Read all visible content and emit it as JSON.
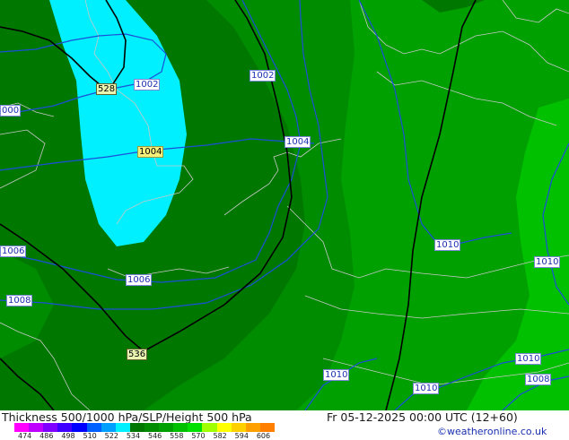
{
  "title": "Thickness 500/1000 hPa/SLP/Height 500 hPa",
  "datetime": "Fr 05-12-2025 00:00 UTC (12+60)",
  "credit": "©weatheronline.co.uk",
  "colors": {
    "band_536_542": "#00a000",
    "band_530_536": "#008c00",
    "band_524_530": "#007800",
    "band_542_548": "#00c000",
    "band_518_524": "#00f0ff",
    "isobar": "#1c4fd8",
    "thickness_line": "#000000",
    "coastline": "#c8c8c8"
  },
  "isobar_labels": [
    {
      "id": "p1002a",
      "text": "1002"
    },
    {
      "id": "p1002b",
      "text": "1002"
    },
    {
      "id": "p1004a",
      "text": "1004"
    },
    {
      "id": "p1004b",
      "text": "1004"
    },
    {
      "id": "p1000",
      "text": "000"
    },
    {
      "id": "p1006a",
      "text": "1006"
    },
    {
      "id": "p1006b",
      "text": "1006"
    },
    {
      "id": "p1008a",
      "text": "1008"
    },
    {
      "id": "p1008b",
      "text": "1008"
    },
    {
      "id": "p1010a",
      "text": "1010"
    },
    {
      "id": "p1010b",
      "text": "1010"
    },
    {
      "id": "p1010c",
      "text": "1010"
    },
    {
      "id": "p1010d",
      "text": "1010"
    },
    {
      "id": "p1010e",
      "text": "1010"
    }
  ],
  "thickness_labels": [
    {
      "id": "t528",
      "text": "528"
    },
    {
      "id": "t536",
      "text": "536"
    }
  ],
  "scale": {
    "colors": [
      "#ff00ff",
      "#c000ff",
      "#8000ff",
      "#4000ff",
      "#0000ff",
      "#0060ff",
      "#00a0ff",
      "#00f0ff",
      "#007800",
      "#008c00",
      "#00a000",
      "#00c000",
      "#00e000",
      "#a0ff00",
      "#ffff00",
      "#ffd000",
      "#ffa000",
      "#ff8000"
    ],
    "ticks": [
      "474",
      "486",
      "498",
      "510",
      "522",
      "534",
      "546",
      "558",
      "570",
      "582",
      "594",
      "606"
    ]
  }
}
